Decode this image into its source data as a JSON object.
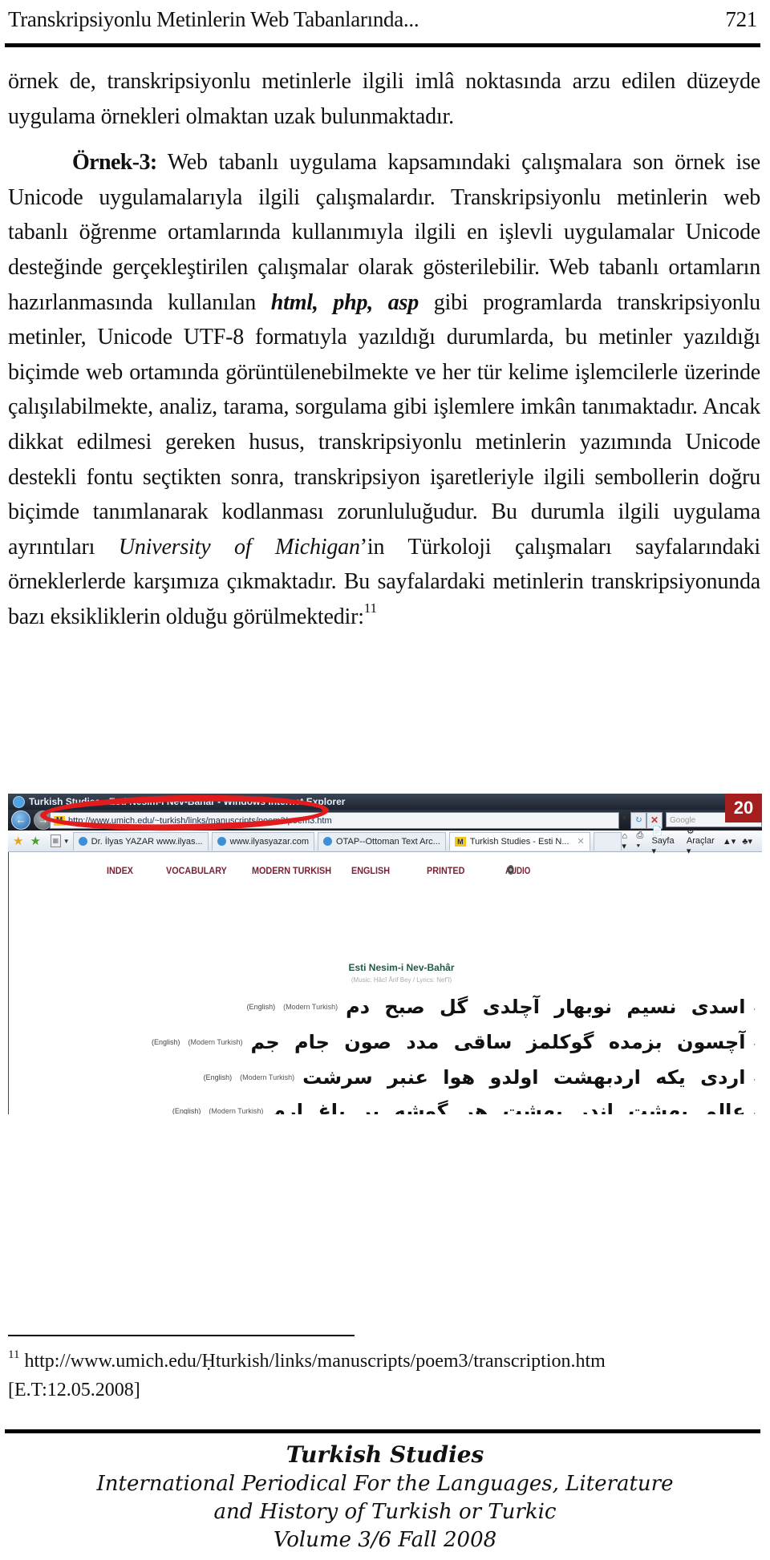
{
  "header": {
    "running_title": "Transkripsiyonlu Metinlerin Web Tabanlarında...",
    "page_number": "721"
  },
  "body": {
    "para1": "örnek de, transkripsiyonlu metinlerle ilgili imlâ noktasında arzu edilen düzeyde uygulama örnekleri olmaktan uzak bulunmaktadır.",
    "para2": {
      "label": "Örnek-3:",
      "part1": " Web tabanlı uygulama kapsamındaki çalışmalara son örnek ise Unicode uygulamalarıyla ilgili çalışmalardır. Transkripsiyonlu metinlerin web tabanlı öğrenme ortamlarında kullanımıyla ilgili en işlevli uygulamalar Unicode desteğinde gerçekleştirilen çalışmalar olarak gösterilebilir.  Web tabanlı ortamların hazırlanmasında kullanılan ",
      "code_terms": "html, php, asp",
      "part2": " gibi programlarda transkripsiyonlu metinler, Unicode UTF-8 formatıyla yazıldığı durumlarda, bu metinler yazıldığı biçimde web ortamında görüntülenebilmekte ve her tür kelime işlemcilerle üzerinde çalışılabilmekte, analiz, tarama, sorgulama gibi işlemlere imkân tanımaktadır. Ancak dikkat edilmesi gereken husus, transkripsiyonlu metinlerin yazımında Unicode destekli fontu seçtikten sonra, transkripsiyon işaretleriyle ilgili sembollerin doğru biçimde tanımlanarak kodlanması zorunluluğudur. Bu durumla ilgili uygulama ayrıntıları ",
      "institution": "University of Michigan",
      "part3": "’in Türkoloji çalışmaları sayfalarındaki örneklerlerde karşımıza çıkmaktadır. Bu sayfalardaki metinlerin transkripsiyonunda bazı eksikliklerin olduğu görülmektedir:",
      "footnote_ref": "11"
    }
  },
  "screenshot": {
    "window_title": "Turkish Studies - Esti Nesim-i Nev-Bahar - Windows Internet Explorer",
    "address_url": "http://www.umich.edu/~turkish/links/manuscripts/poem3/poem3.htm",
    "search_placeholder": "Google",
    "page_badge": "20",
    "tabs": [
      {
        "label": "Dr. İlyas YAZAR www.ilyas...",
        "icon": "ie-icon"
      },
      {
        "label": "www.ilyasyazar.com",
        "icon": "ie-icon"
      },
      {
        "label": "OTAP--Ottoman Text Arc...",
        "icon": "ie-icon"
      },
      {
        "label": "Turkish Studies - Esti N...",
        "icon": "umich-icon",
        "active": true
      }
    ],
    "command_bar": {
      "page": "Sayfa",
      "tools": "Araçlar"
    },
    "site_nav": [
      "INDEX",
      "VOCABULARY",
      "MODERN TURKISH",
      "ENGLISH",
      "PRINTED",
      "AUDIO"
    ],
    "poem_title": "Esti Nesim-i Nev-Bahâr",
    "poem_credit": "(Music: Hâcî Ârif Bey / Lyrics: Nef'î)",
    "verse_link_english": "(English)",
    "verse_link_modern": "(Modern Turkish)",
    "verses": [
      "اسدی نسیم نوبهار آچلدی گل صبح دم",
      "آچسون بزمده گوکلمز ساقی مدد صون جام جم",
      "اردی یکه اردبهشت اولدو هوا عنبر سرشت",
      "عالم بهشت اندر بهشت هر گوشه بر باغ ارم"
    ],
    "verse_markers": [
      ",",
      ",",
      ",",
      ","
    ]
  },
  "footnote": {
    "number": "11",
    "url": "http://www.umich.edu/Ḥturkish/links/manuscripts/poem3/transcription.htm",
    "access_date": "[E.T:12.05.2008]"
  },
  "footer": {
    "journal_title": "Turkish Studies",
    "subtitle_line1": "International Periodical For the Languages, Literature",
    "subtitle_line2": "and History of Turkish or Turkic",
    "volume": "Volume 3/6 Fall 2008"
  }
}
